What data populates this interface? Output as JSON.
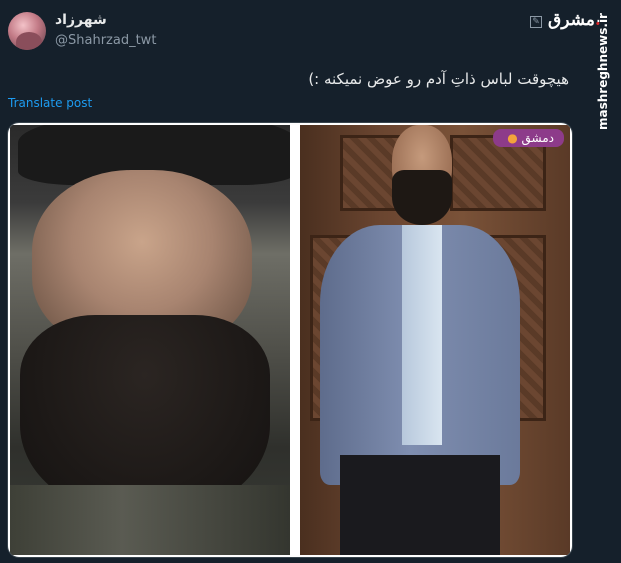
{
  "tweet": {
    "display_name": "شهرزاد",
    "handle": "@Shahrzad_twt",
    "text": "هیچوقت لباس ذاتِ آدم رو عوض نمیکنه :)",
    "translate_label": "Translate post"
  },
  "watermark": {
    "logo_text": "مشرق",
    "side_text": "mashreghnews.ir"
  },
  "media": {
    "location_label": "دمشق",
    "photos": [
      "left-photo",
      "right-photo"
    ]
  },
  "icons": {
    "edit": "edit-icon",
    "location_pin": "pin-icon"
  }
}
